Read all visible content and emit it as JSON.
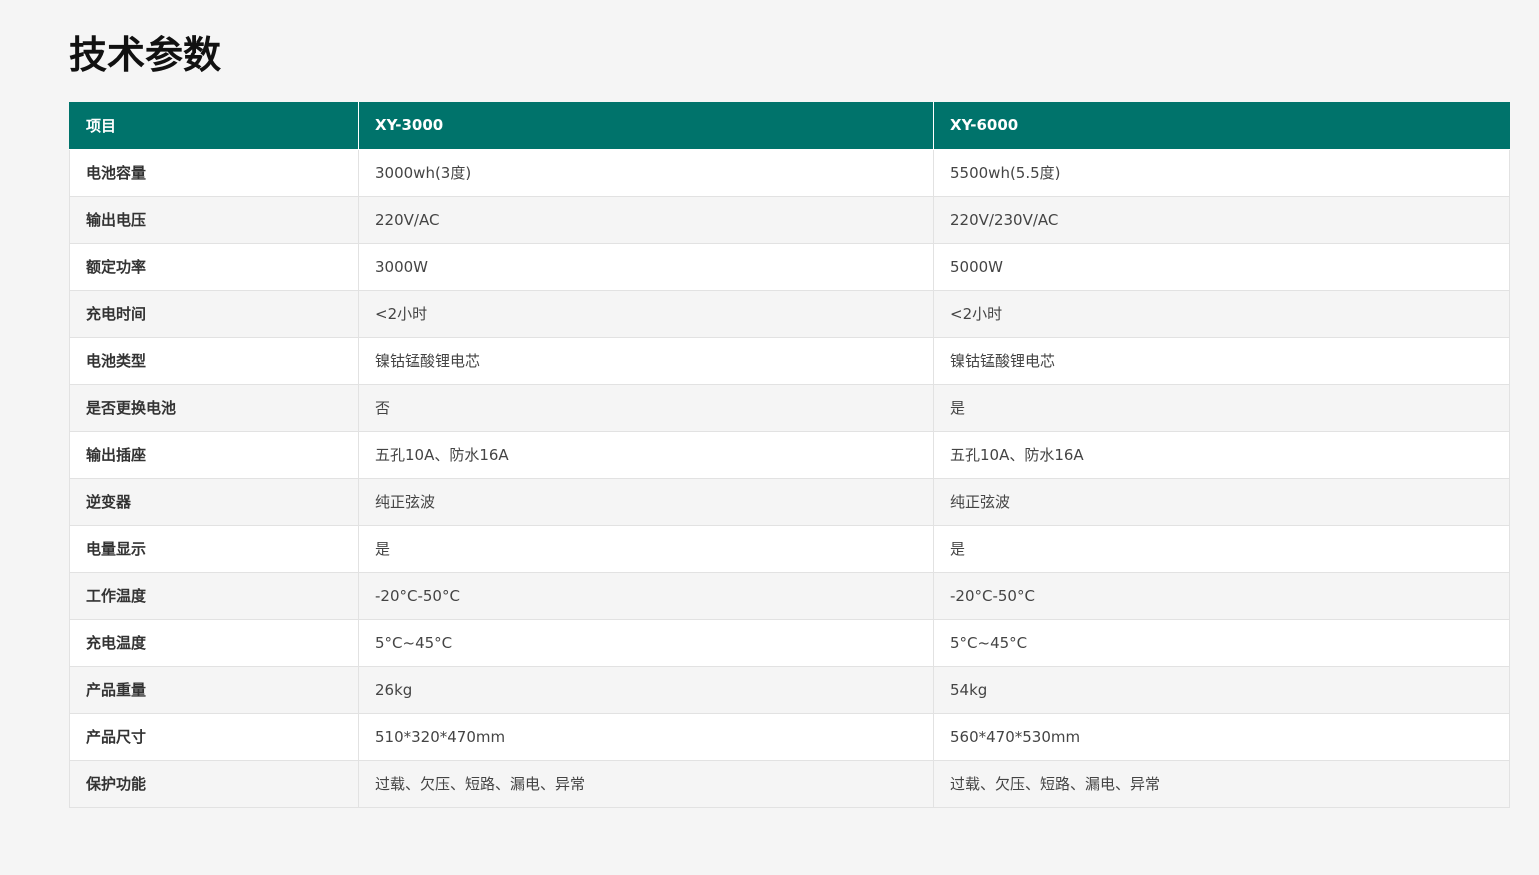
{
  "page": {
    "title": "技术参数"
  },
  "table": {
    "header": [
      "项目",
      "XY-3000",
      "XY-6000"
    ],
    "rows": [
      [
        "电池容量",
        "3000wh(3度)",
        "5500wh(5.5度)"
      ],
      [
        "输出电压",
        "220V/AC",
        "220V/230V/AC"
      ],
      [
        "额定功率",
        "3000W",
        "5000W"
      ],
      [
        "充电时间",
        "<2小时",
        "<2小时"
      ],
      [
        "电池类型",
        "镍钴锰酸锂电芯",
        "镍钴锰酸锂电芯"
      ],
      [
        "是否更换电池",
        "否",
        "是"
      ],
      [
        "输出插座",
        "五孔10A、防水16A",
        "五孔10A、防水16A"
      ],
      [
        "逆变器",
        "纯正弦波",
        "纯正弦波"
      ],
      [
        "电量显示",
        "是",
        "是"
      ],
      [
        "工作温度",
        "-20°C-50°C",
        "-20°C-50°C"
      ],
      [
        "充电温度",
        "5°C~45°C",
        "5°C~45°C"
      ],
      [
        "产品重量",
        "26kg",
        "54kg"
      ],
      [
        "产品尺寸",
        "510*320*470mm",
        "560*470*530mm"
      ],
      [
        "保护功能",
        "过载、欠压、短路、漏电、异常",
        "过载、欠压、短路、漏电、异常"
      ]
    ]
  },
  "colors": {
    "header_bg": "#00736b",
    "header_text": "#ffffff",
    "row_odd": "#ffffff",
    "row_even": "#f5f5f5",
    "page_bg": "#f5f5f5"
  }
}
